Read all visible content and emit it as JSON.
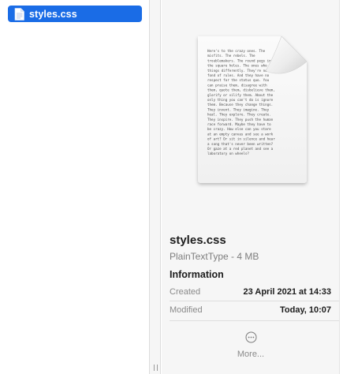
{
  "file_list": {
    "items": [
      {
        "name": "styles.css",
        "selected": true
      }
    ],
    "selection_color": "#1a6ce6"
  },
  "preview": {
    "thumbnail_icon": "text-document-icon",
    "thumbnail_text": "Here's to the crazy ones. The misfits. The rebels. The troublemakers. The round pegs in the square holes. The ones who see things differently. They're not fond of rules. And they have no respect for the status quo. You can praise them, disagree with them, quote them, disbelieve them, glorify or vilify them. About the only thing you can't do is ignore them. Because they change things. They invent. They imagine. They heal. They explore. They create. They inspire. They push the human race forward. Maybe they have to be crazy. How else can you stare at an empty canvas and see a work of art? Or sit in silence and hear a song that's never been written? Or gaze at a red planet and see a laboratory on wheels?",
    "file_name": "styles.css",
    "kind_size": "PlainTextType - 4 MB",
    "info_heading": "Information",
    "info_rows": [
      {
        "label": "Created",
        "value": "23 April 2021 at 14:33"
      },
      {
        "label": "Modified",
        "value": "Today, 10:07"
      }
    ],
    "more_label": "More...",
    "more_icon": "ellipsis-circle-icon"
  }
}
